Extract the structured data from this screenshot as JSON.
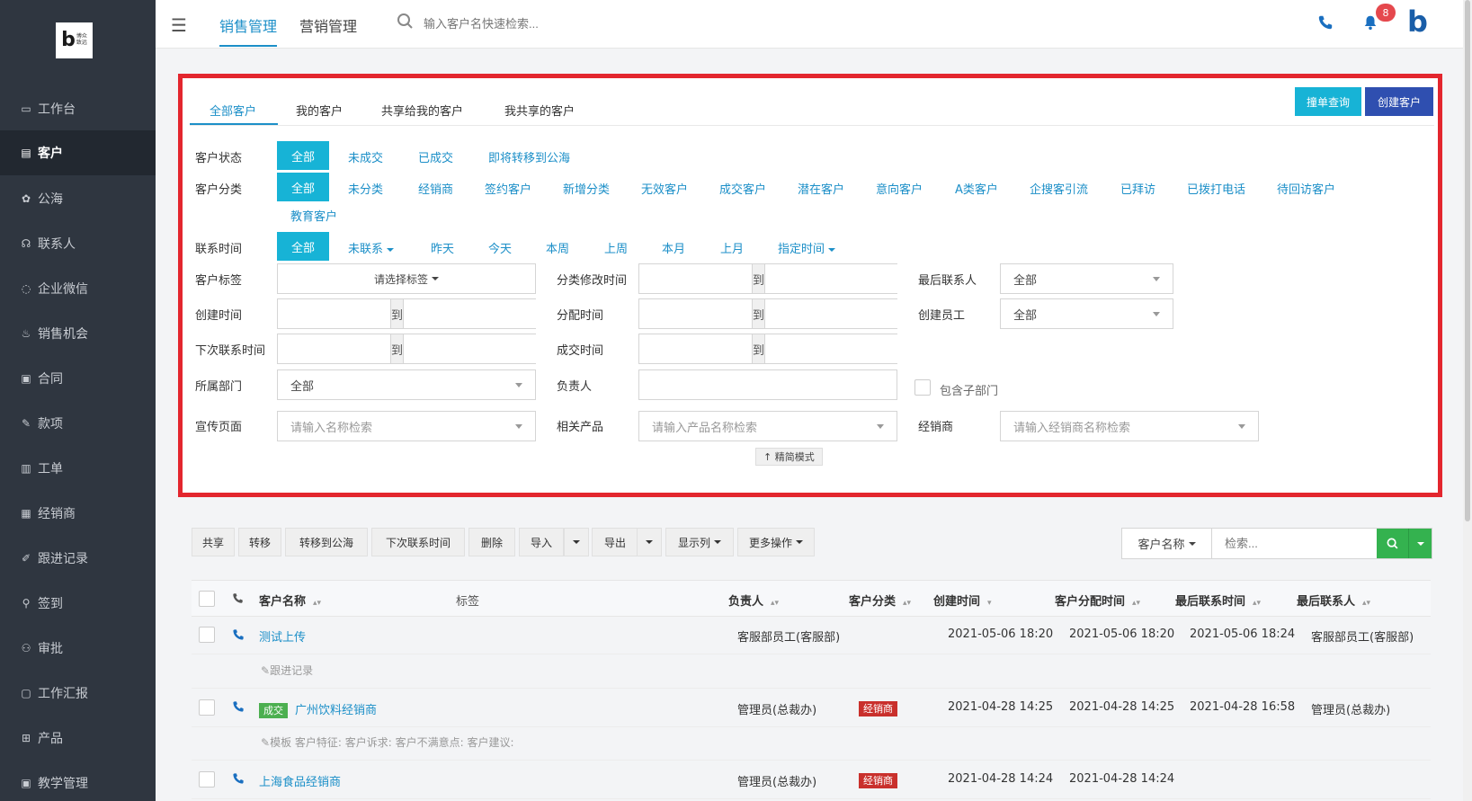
{
  "brand": {
    "logo_letter": "b",
    "logo_text": "博众\n致远"
  },
  "sidebar": {
    "items": [
      {
        "label": "工作台",
        "icon": "monitor-icon"
      },
      {
        "label": "客户",
        "icon": "customer-icon",
        "active": true
      },
      {
        "label": "公海",
        "icon": "sea-icon"
      },
      {
        "label": "联系人",
        "icon": "contact-icon"
      },
      {
        "label": "企业微信",
        "icon": "wechat-icon"
      },
      {
        "label": "销售机会",
        "icon": "moneybag-icon"
      },
      {
        "label": "合同",
        "icon": "contract-icon"
      },
      {
        "label": "款项",
        "icon": "payment-icon"
      },
      {
        "label": "工单",
        "icon": "ticket-icon"
      },
      {
        "label": "经销商",
        "icon": "dealer-icon"
      },
      {
        "label": "跟进记录",
        "icon": "edit-icon"
      },
      {
        "label": "签到",
        "icon": "checkin-icon"
      },
      {
        "label": "审批",
        "icon": "approval-icon"
      },
      {
        "label": "工作汇报",
        "icon": "report-icon"
      },
      {
        "label": "产品",
        "icon": "grid-icon"
      },
      {
        "label": "教学管理",
        "icon": "teaching-icon"
      }
    ]
  },
  "topbar": {
    "tabs": [
      "销售管理",
      "营销管理"
    ],
    "search_placeholder": "输入客户名快速检索...",
    "notification_count": "8",
    "brand_letter": "b"
  },
  "filter": {
    "tabs": [
      "全部客户",
      "我的客户",
      "共享给我的客户",
      "我共享的客户"
    ],
    "btn_single_query": "撞单查询",
    "btn_create": "创建客户",
    "status_label": "客户状态",
    "status_options": [
      "全部",
      "未成交",
      "已成交",
      "即将转移到公海"
    ],
    "category_label": "客户分类",
    "category_options": [
      "全部",
      "未分类",
      "经销商",
      "签约客户",
      "新增分类",
      "无效客户",
      "成交客户",
      "潜在客户",
      "意向客户",
      "A类客户",
      "企搜客引流",
      "已拜访",
      "已拨打电话",
      "待回访客户",
      "教育客户"
    ],
    "contact_time_label": "联系时间",
    "contact_time_options": [
      "全部",
      "未联系",
      "昨天",
      "今天",
      "本周",
      "上周",
      "本月",
      "上月",
      "指定时间"
    ],
    "tag_label": "客户标签",
    "tag_select": "请选择标签",
    "category_modified_label": "分类修改时间",
    "last_contact_person_label": "最后联系人",
    "last_contact_person_value": "全部",
    "create_time_label": "创建时间",
    "assign_time_label": "分配时间",
    "creator_label": "创建员工",
    "creator_value": "全部",
    "next_contact_label": "下次联系时间",
    "deal_time_label": "成交时间",
    "dept_label": "所属部门",
    "dept_value": "全部",
    "owner_label": "负责人",
    "include_sub_dept": "包含子部门",
    "promo_page_label": "宣传页面",
    "promo_page_placeholder": "请输入名称检索",
    "product_label": "相关产品",
    "product_placeholder": "请输入产品名称检索",
    "dealer_label": "经销商",
    "dealer_placeholder": "请输入经销商名称检索",
    "range_to": "到",
    "simple_mode": "↑ 精简模式"
  },
  "toolbar": {
    "buttons": [
      "共享",
      "转移",
      "转移到公海",
      "下次联系时间",
      "删除",
      "导入",
      "导出",
      "显示列",
      "更多操作"
    ],
    "search_field": "客户名称",
    "search_placeholder": "检索..."
  },
  "table": {
    "headers": [
      "客户名称",
      "标签",
      "负责人",
      "客户分类",
      "创建时间",
      "客户分配时间",
      "最后联系时间",
      "最后联系人"
    ],
    "rows": [
      {
        "name": "测试上传",
        "deal_tag": "",
        "owner": "客服部员工(客服部)",
        "category": "",
        "created": "2021-05-06 18:20",
        "assigned": "2021-05-06 18:20",
        "last_contact": "2021-05-06 18:24",
        "last_contact_person": "客服部员工(客服部)",
        "sub": "跟进记录"
      },
      {
        "name": "广州饮料经销商",
        "deal_tag": "成交",
        "owner": "管理员(总裁办)",
        "category": "经销商",
        "created": "2021-04-28 14:25",
        "assigned": "2021-04-28 14:25",
        "last_contact": "2021-04-28 16:58",
        "last_contact_person": "管理员(总裁办)",
        "sub": "模板 客户特征:  客户诉求:  客户不满意点:  客户建议:"
      },
      {
        "name": "上海食品经销商",
        "deal_tag": "",
        "owner": "管理员(总裁办)",
        "category": "经销商",
        "created": "2021-04-28 14:24",
        "assigned": "2021-04-28 14:24",
        "last_contact": "",
        "last_contact_person": "",
        "sub": ""
      }
    ]
  },
  "colors": {
    "accent": "#17b3d6",
    "link": "#1c8fc8",
    "highlight_border": "#e3262e",
    "create_btn": "#2f4fb0",
    "search_btn": "#34b24f"
  }
}
